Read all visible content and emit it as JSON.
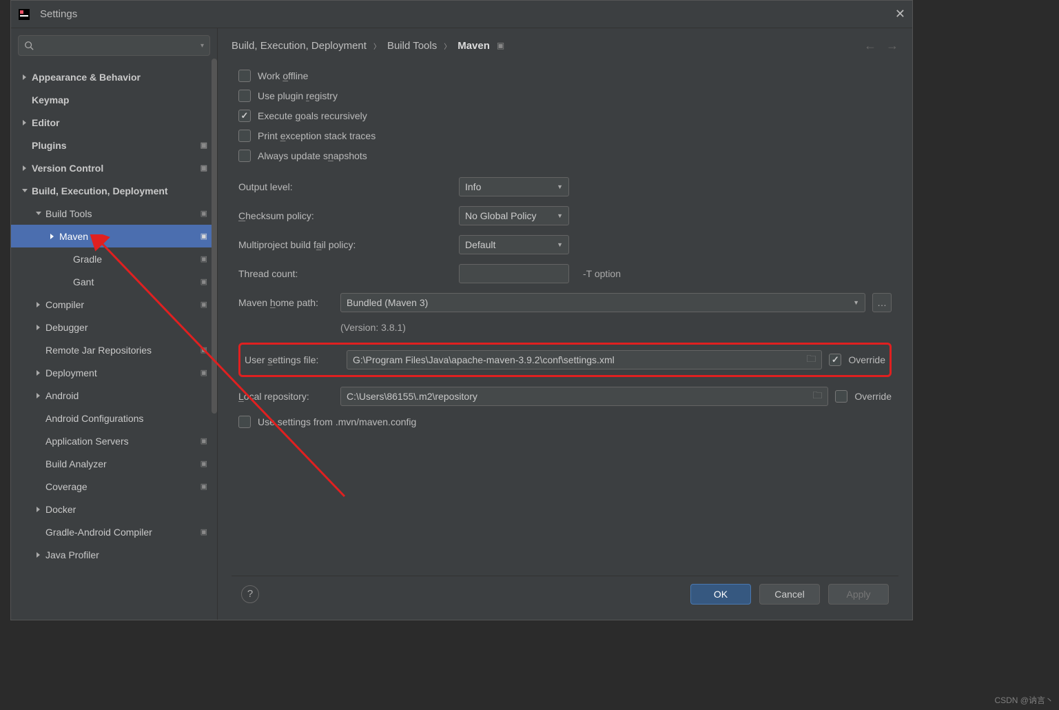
{
  "window": {
    "title": "Settings"
  },
  "search": {
    "placeholder": ""
  },
  "tree": {
    "appearance": "Appearance & Behavior",
    "keymap": "Keymap",
    "editor": "Editor",
    "plugins": "Plugins",
    "version_control": "Version Control",
    "build_execution_deployment": "Build, Execution, Deployment",
    "build_tools": "Build Tools",
    "maven": "Maven",
    "gradle": "Gradle",
    "gant": "Gant",
    "compiler": "Compiler",
    "debugger": "Debugger",
    "remote_jar": "Remote Jar Repositories",
    "deployment": "Deployment",
    "android": "Android",
    "android_config": "Android Configurations",
    "application_servers": "Application Servers",
    "build_analyzer": "Build Analyzer",
    "coverage": "Coverage",
    "docker": "Docker",
    "gradle_android_compiler": "Gradle-Android Compiler",
    "java_profiler": "Java Profiler"
  },
  "breadcrumb": {
    "a": "Build, Execution, Deployment",
    "b": "Build Tools",
    "c": "Maven"
  },
  "checkboxes": {
    "work_offline": "Work offline",
    "use_plugin_registry": "Use plugin registry",
    "execute_goals_recursively": "Execute goals recursively",
    "print_exception": "Print exception stack traces",
    "always_update_snapshots": "Always update snapshots"
  },
  "fields": {
    "output_level": "Output level:",
    "output_level_value": "Info",
    "checksum_policy": "Checksum policy:",
    "checksum_policy_value": "No Global Policy",
    "multiproject": "Multiproject build fail policy:",
    "multiproject_value": "Default",
    "thread_count": "Thread count:",
    "thread_count_value": "",
    "thread_hint": "-T option",
    "maven_home": "Maven home path:",
    "maven_home_value": "Bundled (Maven 3)",
    "version": "(Version: 3.8.1)",
    "user_settings": "User settings file:",
    "user_settings_value": "G:\\Program Files\\Java\\apache-maven-3.9.2\\conf\\settings.xml",
    "local_repo": "Local repository:",
    "local_repo_value": "C:\\Users\\86155\\.m2\\repository",
    "use_settings_from": "Use settings from .mvn/maven.config",
    "override": "Override"
  },
  "footer": {
    "ok": "OK",
    "cancel": "Cancel",
    "apply": "Apply"
  },
  "watermark": "CSDN @讷言丶"
}
